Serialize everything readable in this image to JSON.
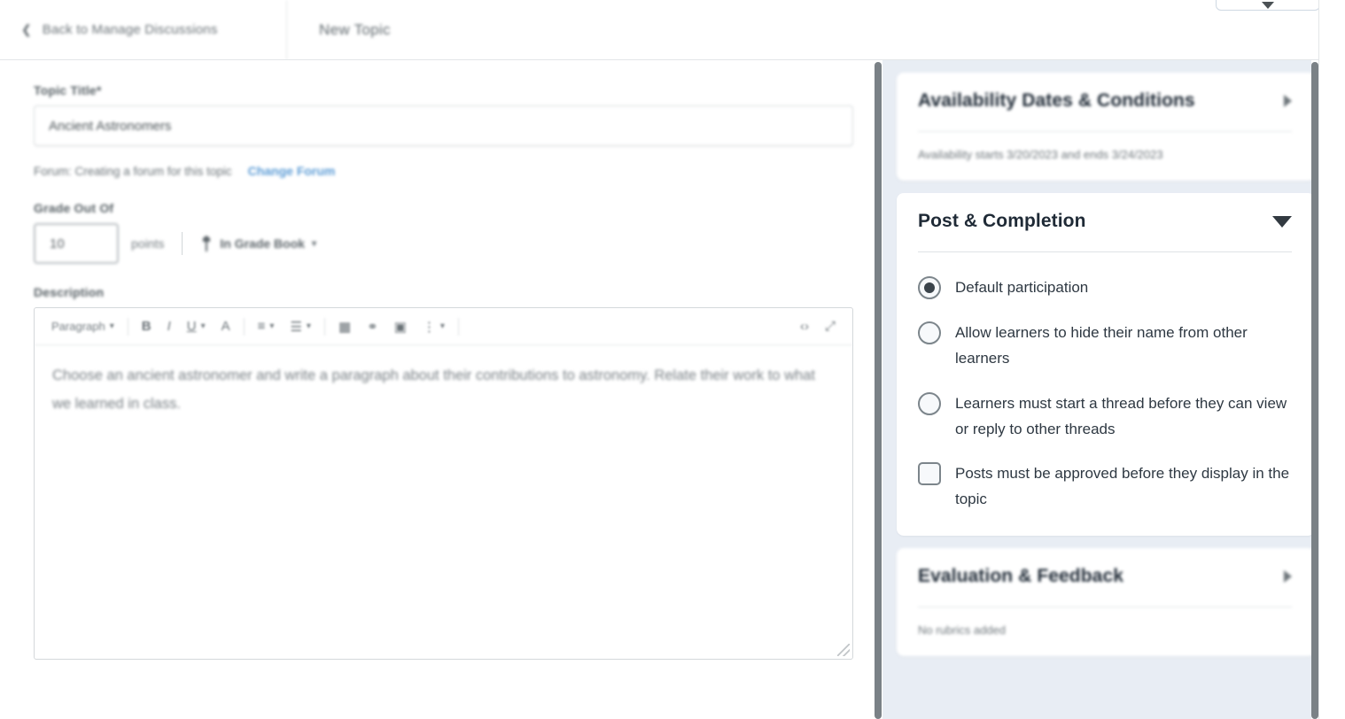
{
  "topbar": {
    "back_label": "Back to Manage Discussions",
    "back_icon": "chevron-left-icon",
    "title": "New Topic",
    "collapse_icon": "chevron-down-icon"
  },
  "form": {
    "topic_title_label": "Topic Title*",
    "topic_title_value": "Ancient Astronomers",
    "forum_text": "Forum: Creating a forum for this topic",
    "change_forum_link": "Change Forum",
    "grade_out_of_label": "Grade Out Of",
    "grade_value": "10",
    "points_label": "points",
    "gradebook_label": "In Grade Book",
    "gradebook_icon": "gradebook-icon",
    "description_label": "Description",
    "description_value": "Choose an ancient astronomer and write a paragraph about their contributions to astronomy. Relate their work to what we learned in class."
  },
  "editor_toolbar": {
    "format_select": "Paragraph",
    "buttons": [
      {
        "name": "bold-icon",
        "glyph": "B"
      },
      {
        "name": "italic-icon",
        "glyph": "I"
      },
      {
        "name": "underline-icon",
        "glyph": "U"
      },
      {
        "name": "text-color-icon",
        "glyph": "A"
      },
      {
        "name": "align-icon",
        "glyph": "≡"
      },
      {
        "name": "list-icon",
        "glyph": "☰"
      },
      {
        "name": "table-icon",
        "glyph": "▦"
      },
      {
        "name": "link-icon",
        "glyph": "⚭"
      },
      {
        "name": "insert-image-icon",
        "glyph": "▣"
      },
      {
        "name": "more-options-icon",
        "glyph": "⋮"
      },
      {
        "name": "html-source-icon",
        "glyph": "‹›"
      },
      {
        "name": "fullscreen-icon",
        "glyph": "⤢"
      }
    ]
  },
  "sidebar": {
    "cards": [
      {
        "title": "Availability Dates & Conditions",
        "subtitle": "Availability starts 3/20/2023 and ends 3/24/2023",
        "toggle_icon": "chevron-right-icon",
        "expanded": false
      },
      {
        "title": "Post & Completion",
        "toggle_icon": "chevron-down-icon",
        "expanded": true,
        "options": [
          {
            "type": "radio",
            "label": "Default participation",
            "selected": true
          },
          {
            "type": "radio",
            "label": "Allow learners to hide their name from other learners",
            "selected": false
          },
          {
            "type": "radio",
            "label": "Learners must start a thread before they can view or reply to other threads",
            "selected": false
          },
          {
            "type": "checkbox",
            "label": "Posts must be approved before they display in the topic",
            "checked": false
          }
        ]
      },
      {
        "title": "Evaluation & Feedback",
        "subtitle": "No rubrics added",
        "toggle_icon": "chevron-right-icon",
        "expanded": false
      }
    ]
  },
  "colors": {
    "link": "#5b9bd5",
    "sidebar_bg": "#e8edf4",
    "text": "#2e3842",
    "scrollbar": "#7a8186"
  }
}
